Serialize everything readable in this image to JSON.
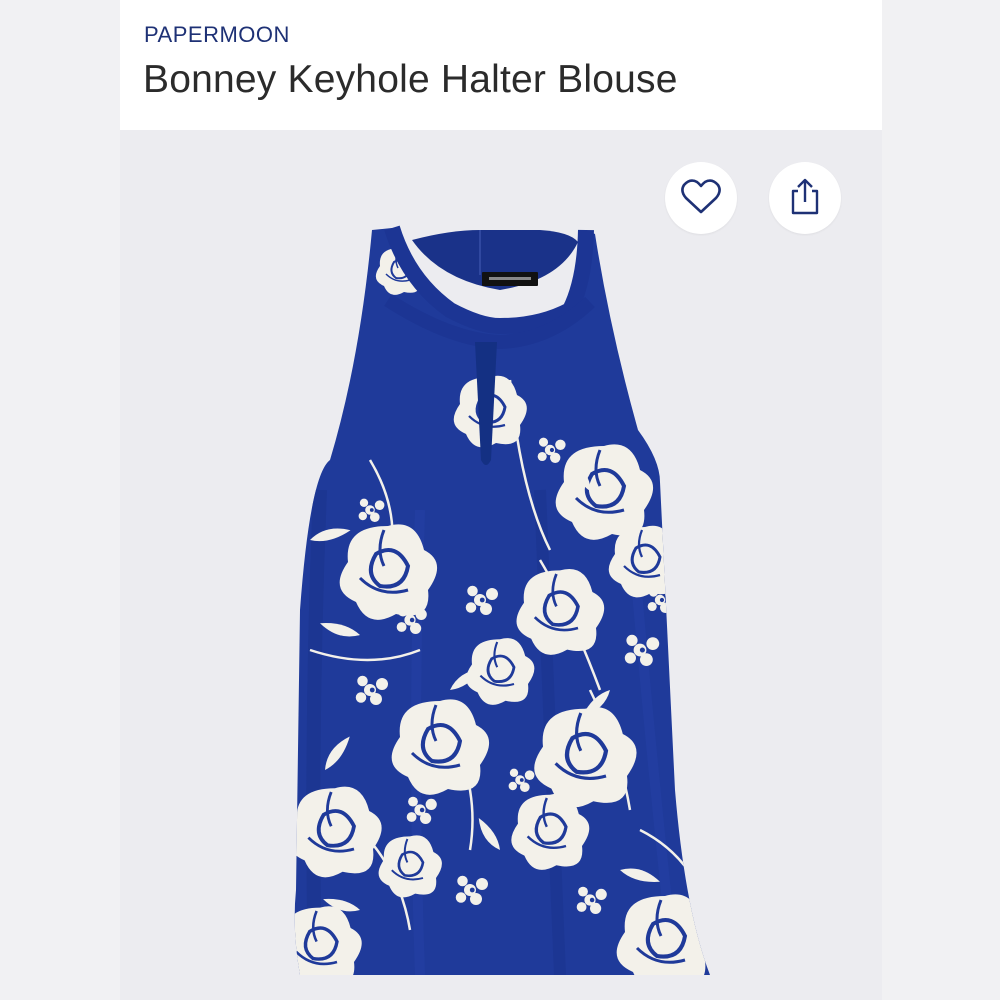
{
  "product": {
    "brand": "PAPERMOON",
    "name": "Bonney Keyhole Halter Blouse",
    "image_alt": "Navy blue sleeveless keyhole halter blouse with white floral print"
  },
  "actions": {
    "favorite_icon": "heart-outline-icon",
    "share_icon": "share-upload-icon"
  },
  "colors": {
    "brand_text": "#1e3175",
    "garment_navy": "#1f3a9a",
    "print_white": "#f4f2ec"
  }
}
